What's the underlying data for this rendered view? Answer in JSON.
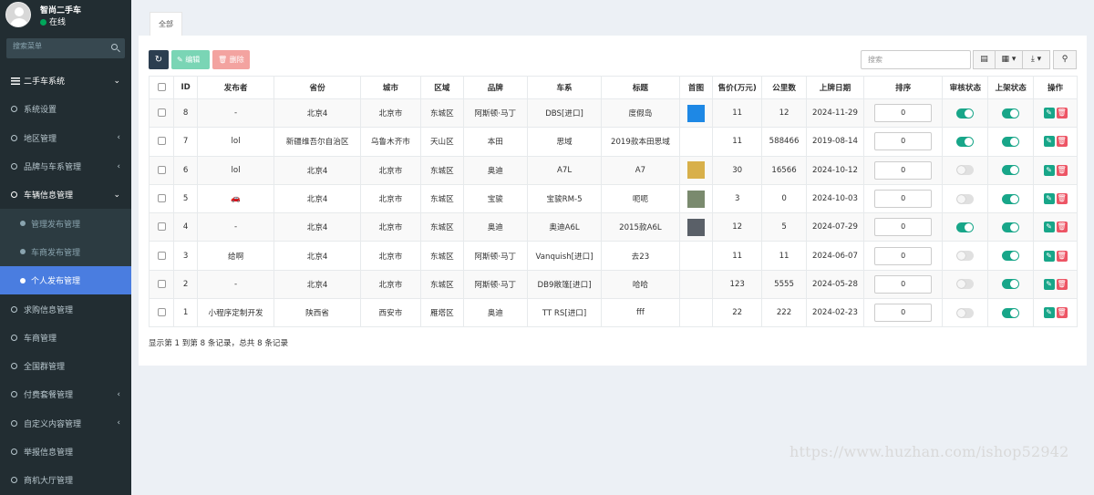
{
  "user": {
    "name": "智尚二手车",
    "status": "在线"
  },
  "sidebar": {
    "search_placeholder": "搜索菜单",
    "items": [
      {
        "label": "二手车系统",
        "chevron": "⌄"
      },
      {
        "label": "系统设置",
        "chevron": ""
      },
      {
        "label": "地区管理",
        "chevron": "‹"
      },
      {
        "label": "品牌与车系管理",
        "chevron": "‹"
      },
      {
        "label": "车辆信息管理",
        "chevron": "⌄"
      },
      {
        "label": "管理发布管理",
        "chevron": ""
      },
      {
        "label": "车商发布管理",
        "chevron": ""
      },
      {
        "label": "个人发布管理",
        "chevron": ""
      },
      {
        "label": "求购信息管理",
        "chevron": ""
      },
      {
        "label": "车商管理",
        "chevron": ""
      },
      {
        "label": "全国群管理",
        "chevron": ""
      },
      {
        "label": "付费套餐管理",
        "chevron": "‹"
      },
      {
        "label": "自定义内容管理",
        "chevron": "‹"
      },
      {
        "label": "举报信息管理",
        "chevron": ""
      },
      {
        "label": "商机大厅管理",
        "chevron": ""
      }
    ]
  },
  "tabs": {
    "all": "全部"
  },
  "toolbar": {
    "refresh_icon": "↻",
    "edit_label": "✎ 编辑",
    "delete_label": "🗑 删除",
    "search_placeholder": "搜索",
    "columns_icon": "▤",
    "grid_icon": "▦ ▾",
    "export_icon": "⤓ ▾",
    "search_icon": "⚲"
  },
  "table": {
    "headers": [
      "",
      "ID",
      "发布者",
      "省份",
      "城市",
      "区域",
      "品牌",
      "车系",
      "标题",
      "首图",
      "售价(万元)",
      "公里数",
      "上牌日期",
      "排序",
      "审核状态",
      "上架状态",
      "操作"
    ],
    "rows": [
      {
        "id": "8",
        "publisher": "-",
        "province": "北京4",
        "city": "北京市",
        "district": "东城区",
        "brand": "阿斯顿·马丁",
        "series": "DBS[进口]",
        "title": "度假岛",
        "thumb": "#1e88e5",
        "price": "11",
        "mileage": "12",
        "date": "2024-11-29",
        "sort": "0",
        "audit": "on",
        "listed": "on"
      },
      {
        "id": "7",
        "publisher": "lol",
        "province": "新疆维吾尔自治区",
        "city": "乌鲁木齐市",
        "district": "天山区",
        "brand": "本田",
        "series": "思域",
        "title": "2019款本田思域",
        "thumb": "",
        "price": "11",
        "mileage": "588466",
        "date": "2019-08-14",
        "sort": "0",
        "audit": "on",
        "listed": "on"
      },
      {
        "id": "6",
        "publisher": "lol",
        "province": "北京4",
        "city": "北京市",
        "district": "东城区",
        "brand": "奥迪",
        "series": "A7L",
        "title": "A7",
        "thumb": "#d8b04a",
        "price": "30",
        "mileage": "16566",
        "date": "2024-10-12",
        "sort": "0",
        "audit": "off",
        "listed": "on"
      },
      {
        "id": "5",
        "publisher": "🚗",
        "province": "北京4",
        "city": "北京市",
        "district": "东城区",
        "brand": "宝骏",
        "series": "宝骏RM-5",
        "title": "呃呃",
        "thumb": "#7a8a6e",
        "price": "3",
        "mileage": "0",
        "date": "2024-10-03",
        "sort": "0",
        "audit": "off",
        "listed": "on"
      },
      {
        "id": "4",
        "publisher": "-",
        "province": "北京4",
        "city": "北京市",
        "district": "东城区",
        "brand": "奥迪",
        "series": "奥迪A6L",
        "title": "2015款A6L",
        "thumb": "#5a6068",
        "price": "12",
        "mileage": "5",
        "date": "2024-07-29",
        "sort": "0",
        "audit": "on",
        "listed": "on"
      },
      {
        "id": "3",
        "publisher": "给啊",
        "province": "北京4",
        "city": "北京市",
        "district": "东城区",
        "brand": "阿斯顿·马丁",
        "series": "Vanquish[进口]",
        "title": "去23",
        "thumb": "",
        "price": "11",
        "mileage": "11",
        "date": "2024-06-07",
        "sort": "0",
        "audit": "off",
        "listed": "on"
      },
      {
        "id": "2",
        "publisher": "-",
        "province": "北京4",
        "city": "北京市",
        "district": "东城区",
        "brand": "阿斯顿·马丁",
        "series": "DB9敞篷[进口]",
        "title": "哈哈",
        "thumb": "",
        "price": "123",
        "mileage": "5555",
        "date": "2024-05-28",
        "sort": "0",
        "audit": "off",
        "listed": "on"
      },
      {
        "id": "1",
        "publisher": "小程序定制开发",
        "province": "陕西省",
        "city": "西安市",
        "district": "雁塔区",
        "brand": "奥迪",
        "series": "TT RS[进口]",
        "title": "fff",
        "thumb": "",
        "price": "22",
        "mileage": "222",
        "date": "2024-02-23",
        "sort": "0",
        "audit": "off",
        "listed": "on"
      }
    ],
    "edit_icon": "✎",
    "delete_icon": "🗑"
  },
  "footer": {
    "info": "显示第 1 到第 8 条记录，总共 8 条记录"
  },
  "watermark": "https://www.huzhan.com/ishop52942"
}
